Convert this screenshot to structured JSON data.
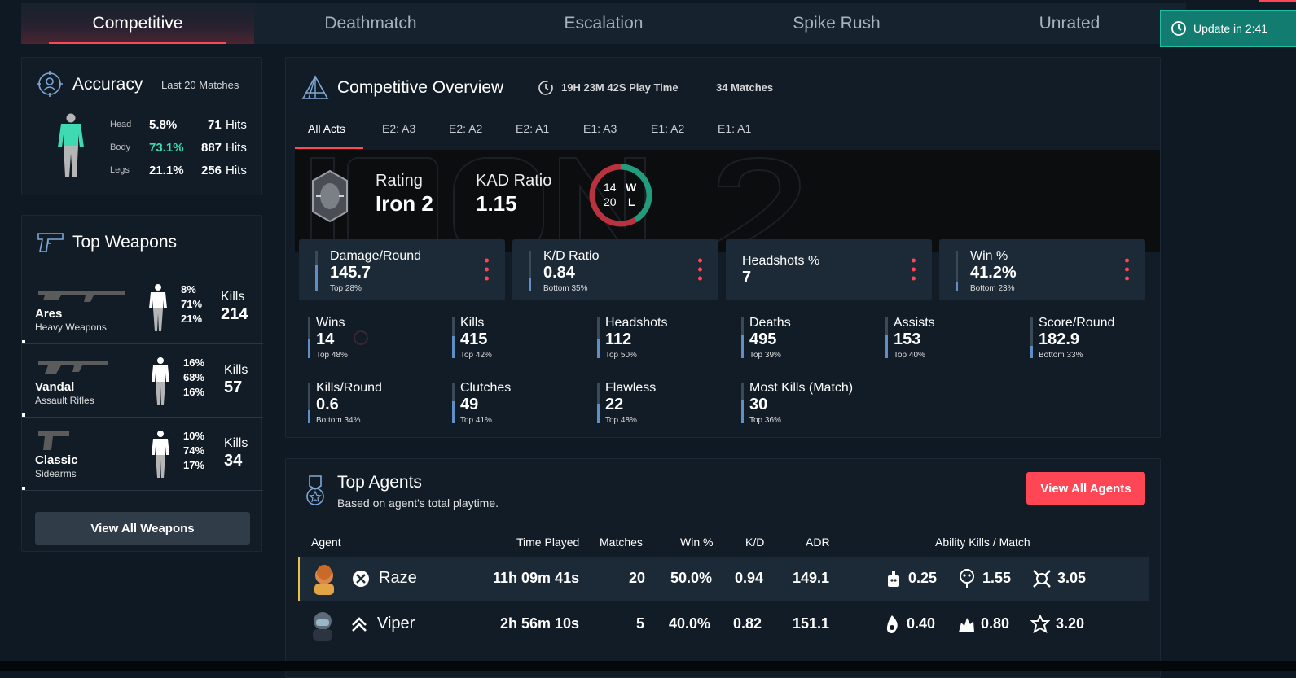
{
  "tabs": [
    "Competitive",
    "Deathmatch",
    "Escalation",
    "Spike Rush",
    "Unrated"
  ],
  "active_tab": "Competitive",
  "update": {
    "label": "Update in 2:41",
    "color": "#117c6f"
  },
  "accuracy": {
    "title": "Accuracy",
    "range": "Last 20 Matches",
    "rows": [
      {
        "part": "Head",
        "pct": "5.8%",
        "hits": "71",
        "unit": "Hits"
      },
      {
        "part": "Body",
        "pct": "73.1%",
        "hits": "887",
        "unit": "Hits"
      },
      {
        "part": "Legs",
        "pct": "21.1%",
        "hits": "256",
        "unit": "Hits"
      }
    ],
    "highlight_color": "#3fd9b2"
  },
  "weapons": {
    "title": "Top Weapons",
    "kills_label": "Kills",
    "items": [
      {
        "name": "Ares",
        "category": "Heavy Weapons",
        "head": "8%",
        "body": "71%",
        "legs": "21%",
        "kills": "214"
      },
      {
        "name": "Vandal",
        "category": "Assault Rifles",
        "head": "16%",
        "body": "68%",
        "legs": "16%",
        "kills": "57"
      },
      {
        "name": "Classic",
        "category": "Sidearms",
        "head": "10%",
        "body": "74%",
        "legs": "17%",
        "kills": "34"
      }
    ],
    "view_all": "View All Weapons"
  },
  "overview": {
    "title": "Competitive Overview",
    "playtime": "19H 23M 42S Play Time",
    "matches": "34 Matches",
    "acts": [
      "All Acts",
      "E2: A3",
      "E2: A2",
      "E2: A1",
      "E1: A3",
      "E1: A2",
      "E1: A1"
    ],
    "active_act": "All Acts",
    "rating_label": "Rating",
    "rating": "Iron 2",
    "kad_label": "KAD Ratio",
    "kad": "1.15",
    "wins": "14",
    "losses": "20",
    "w": "W",
    "l": "L",
    "win_fraction": 0.412,
    "cards": [
      {
        "label": "Damage/Round",
        "value": "145.7",
        "sub": "Top 28%",
        "fill": 0.72
      },
      {
        "label": "K/D Ratio",
        "value": "0.84",
        "sub": "Bottom 35%",
        "fill": 0.35
      },
      {
        "label": "Headshots %",
        "value": "7",
        "sub": "",
        "fill": 0
      },
      {
        "label": "Win %",
        "value": "41.2%",
        "sub": "Bottom 23%",
        "fill": 0.23
      }
    ],
    "stats": [
      {
        "label": "Wins",
        "value": "14",
        "sub": "Top 48%",
        "fill": 0.52
      },
      {
        "label": "Kills",
        "value": "415",
        "sub": "Top 42%",
        "fill": 0.58
      },
      {
        "label": "Headshots",
        "value": "112",
        "sub": "Top 50%",
        "fill": 0.5
      },
      {
        "label": "Deaths",
        "value": "495",
        "sub": "Top 39%",
        "fill": 0.61
      },
      {
        "label": "Assists",
        "value": "153",
        "sub": "Top 40%",
        "fill": 0.6
      },
      {
        "label": "Score/Round",
        "value": "182.9",
        "sub": "Bottom 33%",
        "fill": 0.33
      },
      {
        "label": "Kills/Round",
        "value": "0.6",
        "sub": "Bottom 34%",
        "fill": 0.34
      },
      {
        "label": "Clutches",
        "value": "49",
        "sub": "Top 41%",
        "fill": 0.59
      },
      {
        "label": "Flawless",
        "value": "22",
        "sub": "Top 48%",
        "fill": 0.52
      },
      {
        "label": "Most Kills (Match)",
        "value": "30",
        "sub": "Top 36%",
        "fill": 0.64
      }
    ]
  },
  "agents": {
    "title": "Top Agents",
    "subtitle": "Based on agent's total playtime.",
    "view_all": "View All Agents",
    "headers": {
      "agent": "Agent",
      "time": "Time Played",
      "matches": "Matches",
      "win": "Win %",
      "kd": "K/D",
      "adr": "ADR",
      "ability": "Ability Kills / Match"
    },
    "rows": [
      {
        "name": "Raze",
        "time": "11h 09m 41s",
        "matches": "20",
        "win": "50.0%",
        "kd": "0.94",
        "adr": "149.1",
        "a1": "0.25",
        "a2": "1.55",
        "a3": "3.05"
      },
      {
        "name": "Viper",
        "time": "2h 56m 10s",
        "matches": "5",
        "win": "40.0%",
        "kd": "0.82",
        "adr": "151.1",
        "a1": "0.40",
        "a2": "0.80",
        "a3": "3.20"
      }
    ]
  },
  "colors": {
    "accent": "#ff4655",
    "win": "#1f9e7e",
    "loss": "#b8333f",
    "bar": "#5f8fc4"
  }
}
